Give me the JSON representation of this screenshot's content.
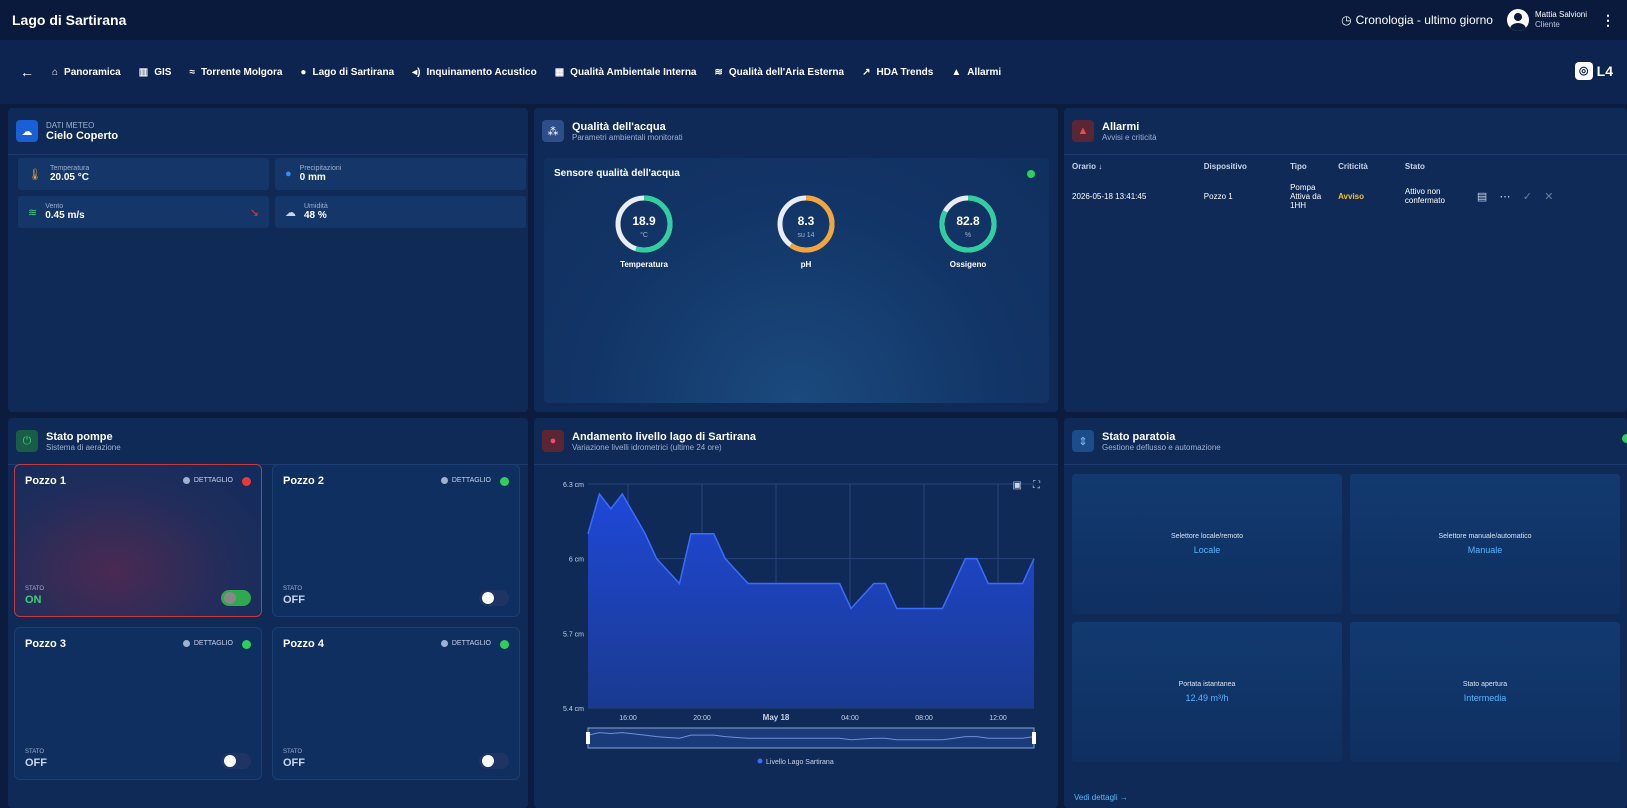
{
  "topbar": {
    "title": "Lago di Sartirana",
    "history": "Cronologia - ultimo giorno",
    "user_name": "Mattia Salvioni",
    "user_role": "Cliente"
  },
  "nav": {
    "items": [
      "Panoramica",
      "GIS",
      "Torrente Molgora",
      "Lago di Sartirana",
      "Inquinamento Acustico",
      "Qualità Ambientale Interna",
      "Qualità dell'Aria Esterna",
      "HDA Trends",
      "Allarmi"
    ],
    "logo": "L4"
  },
  "meteo": {
    "label": "DATI METEO",
    "title": "Cielo Coperto",
    "temp_label": "Temperatura",
    "temp": "20.05 °C",
    "prec_label": "Precipitazioni",
    "prec": "0 mm",
    "wind_label": "Vento",
    "wind": "0.45 m/s",
    "hum_label": "Umidità",
    "hum": "48 %"
  },
  "water": {
    "title": "Qualità dell'acqua",
    "subtitle": "Parametri ambientali monitorati",
    "sensor": "Sensore qualità dell'acqua",
    "g1_val": "18.9",
    "g1_unit": "°C",
    "g1_label": "Temperatura",
    "g1_frac": 0.55,
    "g2_val": "8.3",
    "g2_unit": "su 14",
    "g2_label": "pH",
    "g2_frac": 0.6,
    "g3_val": "82.8",
    "g3_unit": "%",
    "g3_label": "Ossigeno",
    "g3_frac": 0.83
  },
  "alarms": {
    "title": "Allarmi",
    "subtitle": "Avvisi e criticità",
    "cols": [
      "Orario",
      "Dispositivo",
      "Tipo",
      "Criticità",
      "Stato"
    ],
    "row": {
      "time": "2026-05-18 13:41:45",
      "device": "Pozzo 1",
      "type": "Pompa Attiva da 1HH",
      "level": "Avviso",
      "state": "Attivo non confermato"
    }
  },
  "pumps": {
    "title": "Stato pompe",
    "subtitle": "Sistema di aerazione",
    "detail": "DETTAGLIO",
    "state_label": "STATO",
    "p1": "Pozzo 1",
    "p1_state": "ON",
    "p2": "Pozzo 2",
    "p2_state": "OFF",
    "p3": "Pozzo 3",
    "p3_state": "OFF",
    "p4": "Pozzo 4",
    "p4_state": "OFF"
  },
  "chart_data": {
    "type": "area",
    "title": "Andamento livello lago di Sartirana",
    "subtitle": "Variazione livelli idrometrici (ultime 24 ore)",
    "series": [
      {
        "name": "Livello Lago Sartirana",
        "values": [
          6.1,
          6.26,
          6.2,
          6.26,
          6.18,
          6.1,
          6.0,
          5.95,
          5.9,
          6.1,
          6.1,
          6.1,
          6.0,
          5.95,
          5.9,
          5.9,
          5.9,
          5.9,
          5.9,
          5.9,
          5.9,
          5.9,
          5.9,
          5.8,
          5.85,
          5.9,
          5.9,
          5.8,
          5.8,
          5.8,
          5.8,
          5.8,
          5.9,
          6.0,
          6.0,
          5.9,
          5.9,
          5.9,
          5.9,
          6.0
        ]
      }
    ],
    "yticks": [
      "6.3 cm",
      "6 cm",
      "5.7 cm",
      "5.4 cm"
    ],
    "ylim": [
      5.4,
      6.3
    ],
    "xticks": [
      "16:00",
      "20:00",
      "May 18",
      "04:00",
      "08:00",
      "12:00"
    ]
  },
  "gate": {
    "title": "Stato paratoia",
    "subtitle": "Gestione deflusso e automazione",
    "c1_label": "Selettore locale/remoto",
    "c1_val": "Locale",
    "c2_label": "Selettore manuale/automatico",
    "c2_val": "Manuale",
    "c3_label": "Portata istantanea",
    "c3_val": "12.49 m³/h",
    "c4_label": "Stato apertura",
    "c4_val": "Intermedia",
    "link": "Vedi dettagli →"
  }
}
